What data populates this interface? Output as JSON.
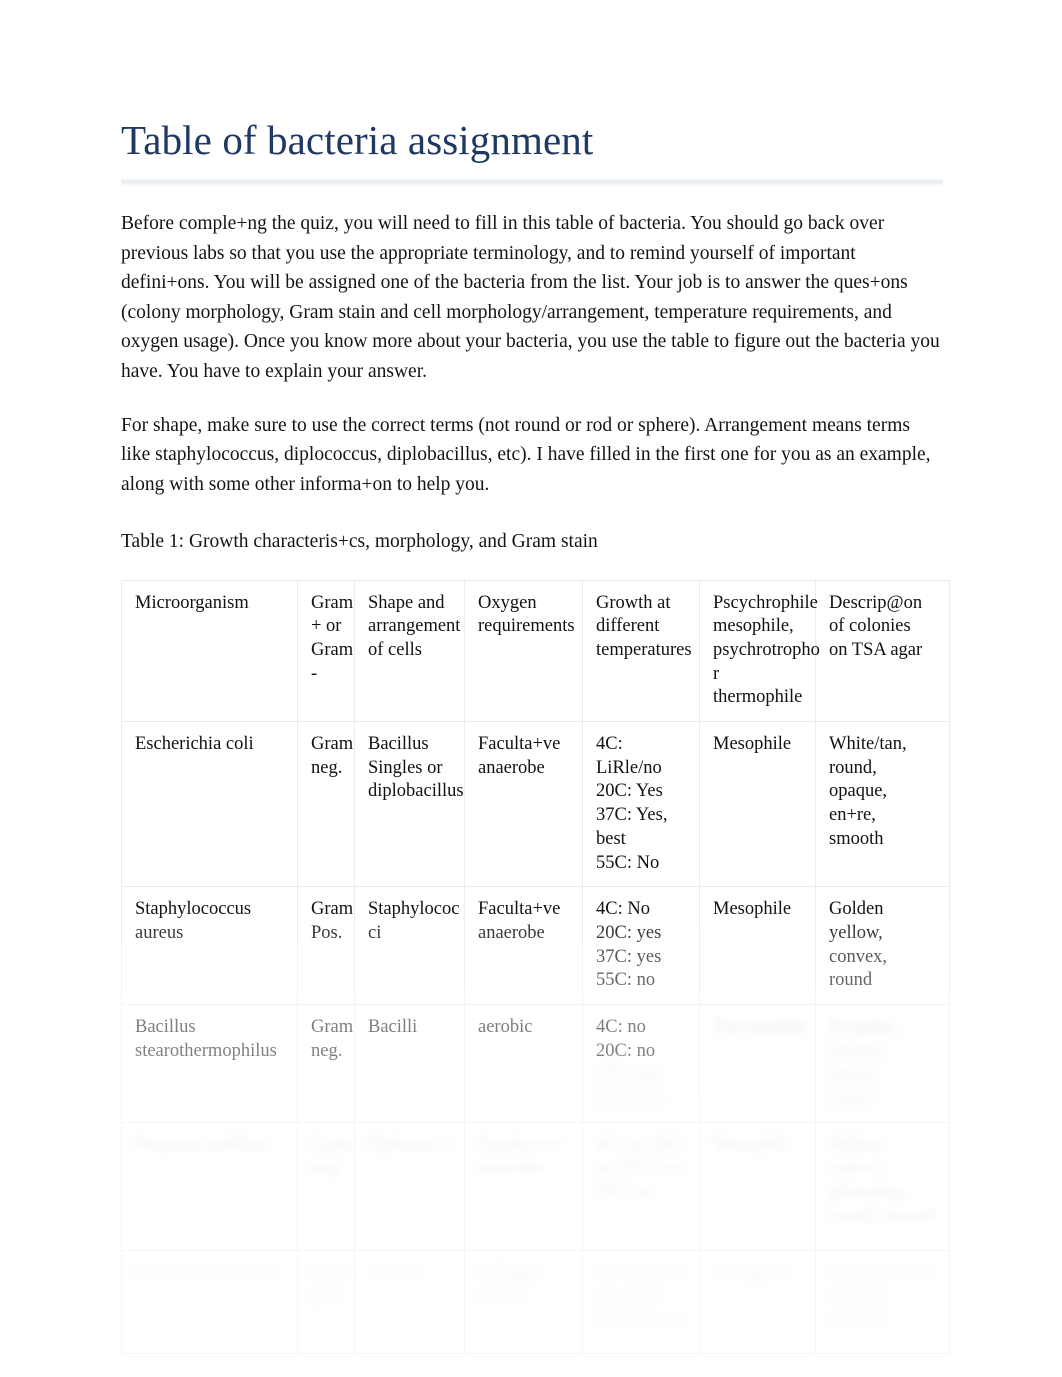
{
  "document": {
    "title": "Table of bacteria assignment",
    "title_color": "#1f3864",
    "paragraph_1": "Before comple+ng the quiz, you will need to fill in this table of bacteria.   You should go back over previous labs so that you use the appropriate terminology, and to remind yourself of important defini+ons.   You will be assigned one of the bacteria from the list.   Your job is to answer the ques+ons (colony morphology, Gram stain and cell morphology/arrangement, temperature requirements, and oxygen usage). Once you know more about your bacteria, you use the table to figure out the bacteria you have. You have to explain your answer.",
    "paragraph_2": "For shape, make sure to use the correct terms (not round or rod or sphere).      Arrangement means terms like staphylococcus, diplococcus, diplobacillus, etc). I have filled in the first one for you as an example, along with some other informa+on to help you.",
    "table_caption": "Table 1: Growth characteris+cs, morphology, and Gram stain"
  },
  "table": {
    "headers": {
      "microorganism": "Microorganism",
      "gram": "Gram + or Gram -",
      "gram_lines": [
        "Gram",
        "+ or",
        "Gram",
        "-"
      ],
      "shape": "Shape and arrangement of cells",
      "shape_lines": [
        "Shape and",
        "arrangement",
        "of cells"
      ],
      "oxygen": "Oxygen requirements",
      "oxygen_lines": [
        "Oxygen",
        "requirements"
      ],
      "growth": "Growth at different temperatures",
      "growth_lines": [
        "Growth at",
        "different",
        "temperatures"
      ],
      "thermal_class": "Pscychrophile mesophile, psychrotropho r thermophile",
      "thermal_class_lines": [
        "Pscychrophile",
        "mesophile,",
        "psychrotropho",
        "r thermophile"
      ],
      "colonies": "Descrip@on of colonies on TSA agar",
      "colonies_lines": [
        "Descrip@on",
        "of colonies",
        "on TSA agar"
      ]
    },
    "rows": [
      {
        "microorganism": "Escherichia coli",
        "gram_lines": [
          "Gram",
          "neg."
        ],
        "shape_lines": [
          "Bacillus",
          "Singles or",
          "diplobacillus"
        ],
        "oxygen_lines": [
          "Faculta+ve",
          "anaerobe"
        ],
        "growth_lines": [
          "4C: LiRle/no",
          "20C: Yes",
          "37C: Yes,",
          "best",
          "55C: No"
        ],
        "thermal_class_lines": [
          "Mesophile"
        ],
        "colonies_lines": [
          "White/tan,",
          "round,",
          "opaque,",
          "en+re,",
          "smooth"
        ],
        "blurred": false
      },
      {
        "microorganism": "Staphylococcus aureus",
        "gram_lines": [
          "Gram",
          "Pos."
        ],
        "shape_lines": [
          "Staphylococ",
          "ci"
        ],
        "oxygen_lines": [
          "Faculta+ve",
          "anaerobe"
        ],
        "growth_lines": [
          "4C: No",
          "20C: yes",
          "37C: yes",
          "55C: no"
        ],
        "thermal_class_lines": [
          "Mesophile"
        ],
        "colonies_lines": [
          "Golden",
          "yellow,",
          "convex,",
          "round"
        ],
        "blurred": false
      },
      {
        "microorganism": "Bacillus stearothermophilus",
        "gram_lines": [
          "Gram",
          "neg."
        ],
        "shape_lines": [
          "Bacilli"
        ],
        "oxygen_lines": [
          "aerobic"
        ],
        "growth_lines": [
          "4C: no",
          "20C: no"
        ],
        "growth_lines_blurred": [
          "37C: yes",
          "55C: yes"
        ],
        "thermal_class_lines_blurred": [
          "Thermophile"
        ],
        "colonies_lines_blurred": [
          "Irregular,",
          "opaque,",
          "raised,",
          "rough"
        ],
        "blurred": "partial"
      },
      {
        "microorganism_blurred": "Neisseria subflava",
        "gram_blurred": "Gram neg.",
        "shape_blurred": "Diplococci",
        "oxygen_blurred": "Faculta+ve anaerobe",
        "growth_blurred": "4C: no 20C: no 37C: yes 55C: no",
        "thermal_class_blurred": "Mesophile",
        "colonies_blurred": "Yellow, convex, glistening, round, smooth",
        "blurred": true
      },
      {
        "microorganism_blurred": "Micrococcus luteus",
        "gram_blurred": "Gram pos.",
        "shape_blurred": "Tetrads",
        "oxygen_blurred": "Obligate aerobe",
        "growth_blurred": "4C: no 20C: yes 37C: yes 55C: no",
        "thermal_class_blurred": "Mesophile",
        "colonies_blurred": "Yellow, round, convex, smooth",
        "blurred": true
      }
    ]
  }
}
